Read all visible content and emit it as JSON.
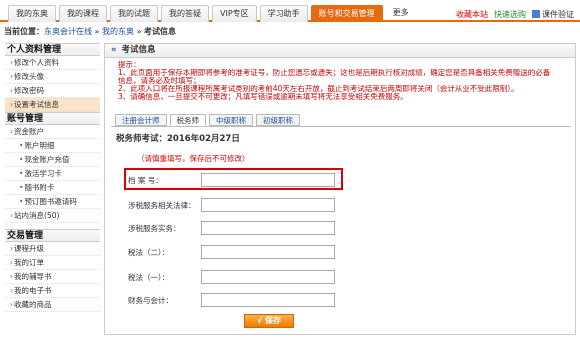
{
  "topnav": {
    "tabs": [
      {
        "label": "我的东奥"
      },
      {
        "label": "我的课程"
      },
      {
        "label": "我的试题"
      },
      {
        "label": "我的答疑"
      },
      {
        "label": "VIP专区"
      },
      {
        "label": "学习助手"
      },
      {
        "label": "账号和交易管理"
      },
      {
        "label": "更多"
      }
    ],
    "links": {
      "favorite": "收藏本站",
      "quick_nav": "快速选购",
      "plugin": "课件验证"
    }
  },
  "breadcrumb": {
    "prefix": "当前位置：",
    "site": "东奥会计在线",
    "sep1": "»",
    "mine": "我的东奥",
    "sep2": "»",
    "current": "考试信息"
  },
  "sidebar": {
    "sections": [
      {
        "title": "个人资料管理",
        "items": [
          "修改个人资料",
          "修改头像",
          "修改密码",
          "设置考试信息"
        ]
      },
      {
        "title": "账号管理",
        "items": [
          "资金账户",
          "账户明细",
          "现金账户充值",
          "激活学习卡",
          "随书附卡",
          "预订图书邀请码",
          "站内消息(50)"
        ]
      },
      {
        "title": "交易管理",
        "items": [
          "课程升级",
          "我的订单",
          "我的辅导书",
          "我的电子书",
          "收藏的商品"
        ]
      }
    ]
  },
  "main": {
    "title_mark": "«",
    "title": "考试信息",
    "notice": {
      "head": "提示：",
      "lines": [
        "1、此页面用于保存本期即将参考的准考证号，防止您遗忘或遗失；这也是后期执行核对成绩，确定您是否具备相关免费赠送的必备",
        "信息，请务必及时填写；",
        "2、此项入口将在所报课程所属考试类别的考前40天左右开放，截止到考试结束后两周即将关闭（会计从业不受此限制）。",
        "3、请确信息，一旦提交不可更改；凡填写错误或逾期未填写将无法享受相关免费服务。"
      ]
    },
    "tabs": [
      "注册会计师",
      "税务师",
      "中级职称",
      "初级职称"
    ],
    "active_tab": "税务师",
    "exam_title": "税务师考试：2016年02月27日",
    "hint": "（请慎重填写，保存后不可修改）",
    "fields": [
      {
        "label": "档    案    号：",
        "value": ""
      },
      {
        "label": "涉税服务相关法律：",
        "value": ""
      },
      {
        "label": "涉税服务实务：",
        "value": ""
      },
      {
        "label": "税法（二）：",
        "value": ""
      },
      {
        "label": "税法（一）：",
        "value": ""
      },
      {
        "label": "财务与会计：",
        "value": ""
      }
    ],
    "save_label": "√ 保存"
  },
  "colors": {
    "accent": "#e86a10",
    "warning": "#d00000",
    "link": "#1a4fa0"
  }
}
